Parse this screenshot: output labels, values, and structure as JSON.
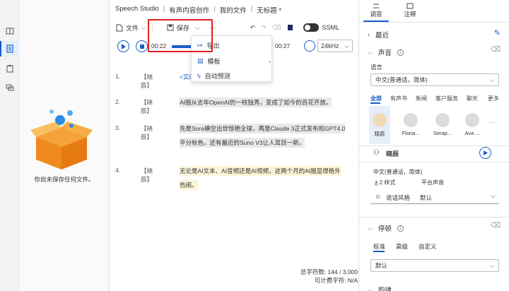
{
  "breadcrumb": [
    "Speech Studio",
    "有声内容创作",
    "我的文件",
    "无标题 *"
  ],
  "toolbar": {
    "file_label": "文件",
    "save_label": "保存",
    "more_label": "···",
    "ssml_label": "SSML"
  },
  "player": {
    "time_start": "00:22",
    "time_end": "00:27",
    "sample_rate": "24kHz"
  },
  "menu": {
    "export": "导出",
    "template": "模板",
    "auto_preview": "自动预测"
  },
  "file_panel": {
    "empty_text": "你尚未保存任何文件。"
  },
  "paragraphs": [
    {
      "num": "1.",
      "tag": "【晓辰】",
      "text": "<实时> ……好像加了速。 </>"
    },
    {
      "num": "2.",
      "tag": "【晓辰】",
      "text": "AI圈从去年OpenAI的一枝独秀，变成了如今的百花齐放。"
    },
    {
      "num": "3.",
      "tag": "【晓辰】",
      "line1": "先是Sora横空出世惊艳全球，再是Claude 3正式发布和GPT4.0",
      "line2": "平分秋色，还有最近的Suno V3让人耳目一新。"
    },
    {
      "num": "4.",
      "tag": "【晓辰】",
      "line1": "无论是AI文本、AI音频还是AI视频，这两个月的AI圈显得格外",
      "line2": "热闹。"
    }
  ],
  "counts": {
    "total": "总字符数: 144 / 3,000",
    "billable": "可计费字符: N/A"
  },
  "right_panel": {
    "tabs": [
      "调音",
      "注释"
    ],
    "sections": {
      "recent": "最近",
      "voice": "声音",
      "pause": "停顿",
      "rhythm": "韵律"
    },
    "language_label": "语言",
    "language_value": "中文(普通话，简体)",
    "categories": [
      "全部",
      "有声书",
      "新闻",
      "客户服务",
      "聊天",
      "更多"
    ],
    "voices": [
      "晓辰",
      "Floria...",
      "Serap...",
      "Ava ..."
    ],
    "selected_voice": "晓辰",
    "voice_lang": "中文(普通话，简体)",
    "voice_styles": "2 样式",
    "voice_type": "平台声音",
    "style_label": "说话风格",
    "style_value": "默认",
    "pause_tabs": [
      "标准",
      "高级",
      "自定义"
    ],
    "pause_value": "默认"
  }
}
